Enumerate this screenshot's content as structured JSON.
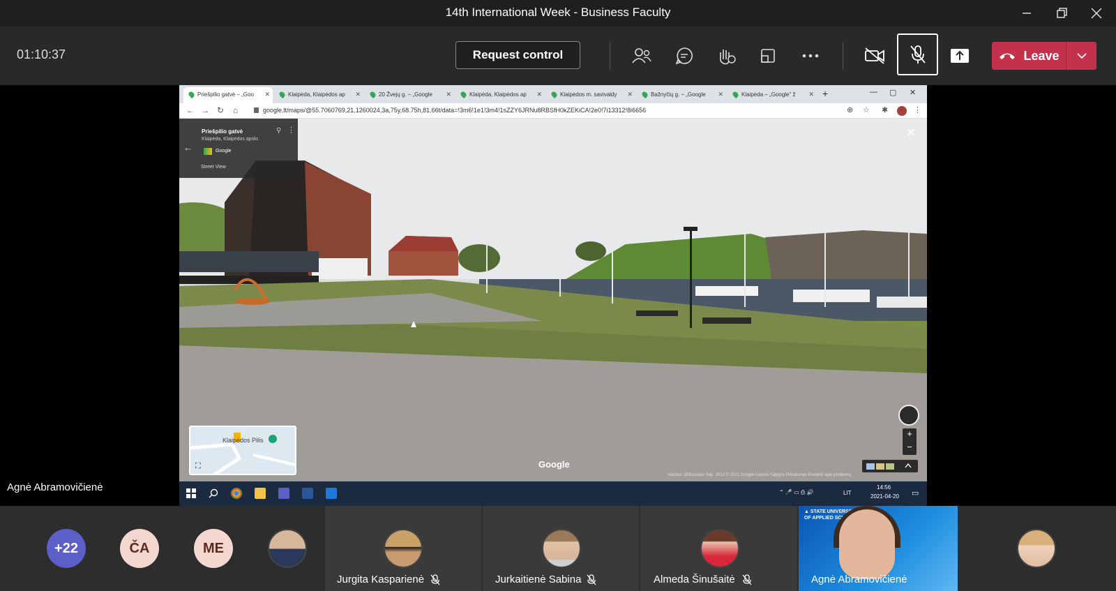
{
  "window": {
    "title": "14th International Week - Business Faculty",
    "controls": [
      "minimize",
      "restore",
      "close"
    ]
  },
  "toolbar": {
    "timer": "01:10:37",
    "request_control_label": "Request control",
    "leave_label": "Leave",
    "accent": "#c4314b"
  },
  "browser": {
    "tabs": [
      {
        "label": "Priešpilio gatvė – „Goo"
      },
      {
        "label": "Klaipėda, Klaipėdos ap"
      },
      {
        "label": "20 Žvejų g. – „Google"
      },
      {
        "label": "Klaipėda, Klaipėdos ap"
      },
      {
        "label": "Klaipėdos m. savivaldy"
      },
      {
        "label": "Bažnyčių g. – „Google"
      },
      {
        "label": "Klaipėda – „Google\" ž"
      }
    ],
    "url": "google.lt/maps/@55.7060769,21.1260024,3a,75y,68.75h,81.66t/data=!3m6!1e1!3m4!1sZZY6JRNu8RBSfH0kZEKiCA!2e0!7i13312!8i6656"
  },
  "streetview": {
    "place_title": "Priešpilio gatvė",
    "place_subtitle": "Klaipėda, Klaipėdos apskr.",
    "provider": "Google",
    "mode_label": "Street View",
    "minimap_label": "Klaipėdos Pilis",
    "watermark": "Google",
    "footer": "Vaizdas užfiksuotas: liep. 2012     © 2021 Google     Lietuva     Sąlygos     Privatumas     Pranešti apie problemą"
  },
  "taskbar": {
    "lang": "LIT",
    "time": "14:56",
    "date": "2021-04-20"
  },
  "presenter": {
    "name": "Agnė Abramovičienė"
  },
  "participants": {
    "more_count": "+22",
    "initials": [
      "ČA",
      "ME"
    ],
    "named": [
      {
        "name": "Jurgita Kasparienė",
        "muted": true
      },
      {
        "name": "Jurkaitienė Sabina",
        "muted": true
      },
      {
        "name": "Almeda Šinušaitė",
        "muted": true
      },
      {
        "name": "Agnė Abramovičienė",
        "muted": false
      }
    ]
  }
}
